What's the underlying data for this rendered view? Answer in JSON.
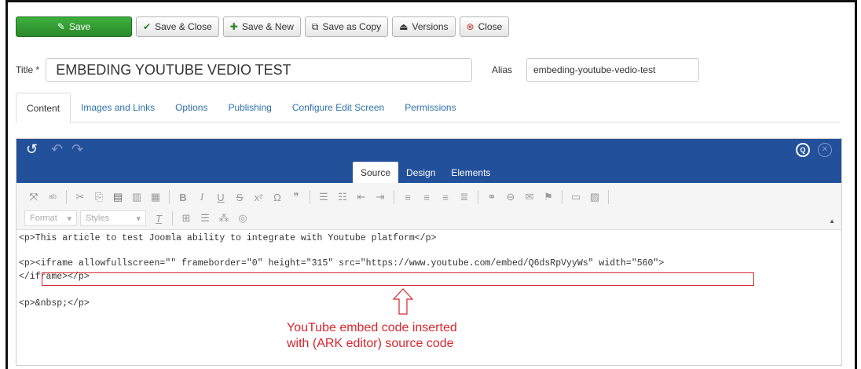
{
  "toolbar": {
    "save": "Save",
    "save_close": "Save & Close",
    "save_new": "Save & New",
    "save_copy": "Save as Copy",
    "versions": "Versions",
    "close": "Close"
  },
  "form": {
    "title_label": "Title *",
    "title_value": "EMBEDING YOUTUBE VEDIO TEST",
    "alias_label": "Alias",
    "alias_value": "embeding-youtube-vedio-test"
  },
  "tabs": [
    "Content",
    "Images and Links",
    "Options",
    "Publishing",
    "Configure Edit Screen",
    "Permissions"
  ],
  "editor": {
    "mode_tabs": [
      "Source",
      "Design",
      "Elements"
    ],
    "format_label": "Format",
    "styles_label": "Styles",
    "source_lines": [
      "<p>This article to test Joomla ability to integrate with Youtube platform</p>",
      "<p><iframe allowfullscreen=\"\" frameborder=\"0\" height=\"315\" src=\"https://www.youtube.com/embed/Q6dsRpVyyWs\" width=\"560\">",
      "</iframe></p>",
      "<p>&nbsp;</p>"
    ]
  },
  "annotation": {
    "line1": "YouTube embed code inserted",
    "line2": "with (ARK editor) source code",
    "color": "#d9262e"
  },
  "colors": {
    "save_green": "#2b8a2b",
    "editor_header": "#23509a",
    "link_blue": "#3071a9"
  }
}
